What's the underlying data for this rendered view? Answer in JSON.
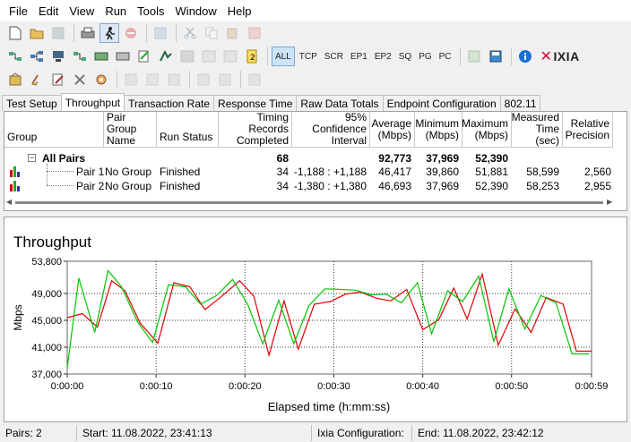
{
  "menu": [
    "File",
    "Edit",
    "View",
    "Run",
    "Tools",
    "Window",
    "Help"
  ],
  "toolbar": {
    "row1_icons": [
      "new-file-icon",
      "open-folder-icon",
      "save-icon",
      "print-icon",
      "run-icon",
      "stop-icon",
      "copy-report-icon",
      "cut-icon",
      "copy-icon",
      "paste-icon",
      "delete-icon"
    ],
    "row2_icons": [
      "add-pair-icon",
      "add-multicast-icon",
      "network-icon",
      "edit-pair-icon",
      "edit-multicast-icon",
      "rename-icon",
      "script-icon",
      "endpoint-icon",
      "multi-icon",
      "count-icon"
    ],
    "protocols": [
      "ALL",
      "TCP",
      "SCR",
      "EP1",
      "EP2",
      "SQ",
      "PG",
      "PC"
    ],
    "active_protocol": "ALL",
    "brand": "IXIA",
    "help_icon": "info-icon"
  },
  "tabs": [
    "Test Setup",
    "Throughput",
    "Transaction Rate",
    "Response Time",
    "Raw Data Totals",
    "Endpoint Configuration",
    "802.11"
  ],
  "active_tab": "Throughput",
  "grid": {
    "headers": [
      "Group",
      "Pair Group\nName",
      "Run Status",
      "Timing Records\nCompleted",
      "95% Confidence\nInterval",
      "Average\n(Mbps)",
      "Minimum\n(Mbps)",
      "Maximum\n(Mbps)",
      "Measured\nTime (sec)",
      "Relative\nPrecision"
    ],
    "all_pairs": {
      "label": "All Pairs",
      "records": "68",
      "average": "92,773",
      "minimum": "37,969",
      "maximum": "52,390"
    },
    "rows": [
      {
        "pair": "Pair 1",
        "group": "No Group",
        "status": "Finished",
        "records": "34",
        "ci": "-1,188 : +1,188",
        "average": "46,417",
        "minimum": "39,860",
        "maximum": "51,881",
        "time": "58,599",
        "precision": "2,560"
      },
      {
        "pair": "Pair 2",
        "group": "No Group",
        "status": "Finished",
        "records": "34",
        "ci": "-1,380 : +1,380",
        "average": "46,693",
        "minimum": "37,969",
        "maximum": "52,390",
        "time": "58,253",
        "precision": "2,955"
      }
    ]
  },
  "chart_data": {
    "type": "line",
    "title": "Throughput",
    "xlabel": "Elapsed time (h:mm:ss)",
    "ylabel": "Mbps",
    "ylim": [
      37000,
      53800
    ],
    "xlim": [
      0,
      59
    ],
    "yticks": [
      "53,800",
      "49,000",
      "45,000",
      "41,000",
      "37,000"
    ],
    "ytick_values": [
      53800,
      49000,
      45000,
      41000,
      37000
    ],
    "xticks": [
      "0:00:00",
      "0:00:10",
      "0:00:20",
      "0:00:30",
      "0:00:40",
      "0:00:50",
      "0:00:59"
    ],
    "xtick_values": [
      0,
      10,
      20,
      30,
      40,
      50,
      59
    ],
    "grid": true,
    "series": [
      {
        "color": "#e00000",
        "x": [
          0,
          1.7,
          3.4,
          5,
          6.5,
          8.2,
          10.2,
          12,
          13.8,
          15.5,
          17.3,
          19.4,
          21,
          22.7,
          24.4,
          26,
          27.8,
          29.6,
          31.3,
          33,
          34.8,
          36.4,
          38.2,
          40,
          41.8,
          43.5,
          45,
          46.7,
          48.5,
          50.4,
          52.2,
          53.9,
          55.8,
          57.3,
          59
        ],
        "y": [
          45400,
          46000,
          44000,
          50900,
          49400,
          44600,
          41600,
          50600,
          50000,
          46600,
          48500,
          50900,
          48600,
          39800,
          47900,
          40700,
          47400,
          47800,
          48900,
          49200,
          48300,
          47900,
          49600,
          43600,
          45100,
          49800,
          45200,
          51900,
          41300,
          46700,
          43200,
          48400,
          47400,
          40400,
          40400
        ]
      },
      {
        "color": "#00c800",
        "x": [
          0,
          1.3,
          3.1,
          4.6,
          6.1,
          7.9,
          9.6,
          11.4,
          13.3,
          15,
          16.8,
          18.6,
          20.3,
          22,
          23.8,
          25.5,
          27.2,
          29,
          30.8,
          32.5,
          34.2,
          35.9,
          37.6,
          39.4,
          41,
          42.8,
          44.5,
          46.3,
          48,
          49.7,
          51.5,
          53.3,
          55,
          56.8,
          58.7
        ],
        "y": [
          37900,
          51300,
          43200,
          52400,
          50000,
          44800,
          41700,
          50300,
          50000,
          47400,
          48700,
          51100,
          47400,
          41500,
          48000,
          41500,
          47200,
          49700,
          49600,
          49500,
          48800,
          48900,
          47600,
          50600,
          43000,
          49400,
          47800,
          51600,
          41800,
          49700,
          43700,
          48700,
          47600,
          40000,
          40000
        ]
      }
    ]
  },
  "status": {
    "pairs": "Pairs: 2",
    "start": "Start: 11.08.2022, 23:41:13",
    "config": "Ixia Configuration:",
    "end": "End: 11.08.2022, 23:42:12"
  }
}
